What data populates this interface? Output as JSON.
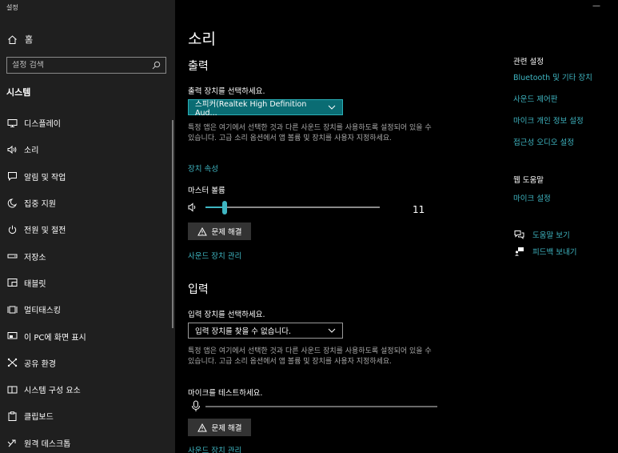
{
  "window": {
    "app_title": "설정",
    "minimize": "—"
  },
  "sidebar": {
    "home_label": "홈",
    "home_icon": "home-icon",
    "search_placeholder": "설정 검색",
    "search_icon": "search-icon",
    "section_label": "시스템",
    "items": [
      {
        "label": "디스플레이",
        "icon": "display-icon"
      },
      {
        "label": "소리",
        "icon": "speaker-icon"
      },
      {
        "label": "알림 및 작업",
        "icon": "notification-icon"
      },
      {
        "label": "집중 지원",
        "icon": "moon-icon"
      },
      {
        "label": "전원 및 절전",
        "icon": "power-icon"
      },
      {
        "label": "저장소",
        "icon": "storage-icon"
      },
      {
        "label": "태블릿",
        "icon": "tablet-icon"
      },
      {
        "label": "멀티태스킹",
        "icon": "multitasking-icon"
      },
      {
        "label": "이 PC에 화면 표시",
        "icon": "project-icon"
      },
      {
        "label": "공유 환경",
        "icon": "shared-experiences-icon"
      },
      {
        "label": "시스템 구성 요소",
        "icon": "components-icon"
      },
      {
        "label": "클립보드",
        "icon": "clipboard-icon"
      },
      {
        "label": "원격 데스크톱",
        "icon": "remote-desktop-icon"
      }
    ]
  },
  "main": {
    "title": "소리",
    "output": {
      "heading": "출력",
      "select_label": "출력 장치를 선택하세요.",
      "device_value": "스피커(Realtek High Definition Aud...",
      "description": "특정 앱은 여기에서 선택한 것과 다른 사운드 장치를 사용하도록 설정되어 있을 수 있습니다. 고급 소리 옵션에서 앱 볼륨 및 장치를 사용자 지정하세요.",
      "device_properties_link": "장치 속성",
      "master_volume_label": "마스터 볼륨",
      "volume_value": "11",
      "volume_level": 11,
      "troubleshoot_label": "문제 해결",
      "manage_devices_link": "사운드 장치 관리"
    },
    "input": {
      "heading": "입력",
      "select_label": "입력 장치를 선택하세요.",
      "device_value": "입력 장치를 찾을 수 없습니다.",
      "description": "특정 앱은 여기에서 선택한 것과 다른 사운드 장치를 사용하도록 설정되어 있을 수 있습니다. 고급 소리 옵션에서 앱 볼륨 및 장치를 사용자 지정하세요.",
      "test_mic_label": "마이크를 테스트하세요.",
      "troubleshoot_label": "문제 해결",
      "manage_devices_link": "사운드 장치 관리"
    }
  },
  "right": {
    "related_heading": "관련 설정",
    "related_links": [
      "Bluetooth 및 기타 장치",
      "사운드 제어판",
      "마이크 개인 정보 설정",
      "접근성 오디오 설정"
    ],
    "help_heading": "웹 도움말",
    "help_links": [
      "마이크 설정"
    ],
    "get_help": "도움말 보기",
    "feedback": "피드백 보내기"
  },
  "colors": {
    "accent": "#3fb6c2",
    "sidebar_bg": "#1f1f1f",
    "main_bg": "#000000",
    "dropdown_active": "#0a6c73"
  }
}
